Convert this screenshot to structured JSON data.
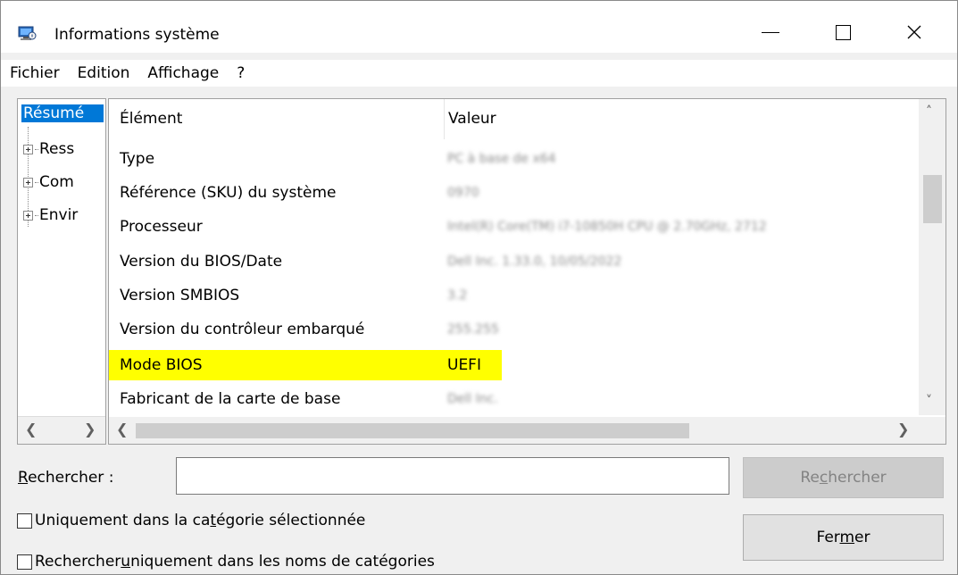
{
  "window": {
    "title": "Informations système",
    "icon": "system-info-icon"
  },
  "menu": [
    "Fichier",
    "Edition",
    "Affichage",
    "?"
  ],
  "tree": {
    "root": "Résumé",
    "items": [
      "Ress",
      "Com",
      "Envir"
    ]
  },
  "list": {
    "headers": {
      "element": "Élément",
      "value": "Valeur"
    },
    "rows": [
      {
        "name": "Type",
        "value": "PC à base de x64"
      },
      {
        "name": "Référence (SKU) du système",
        "value": "0970"
      },
      {
        "name": "Processeur",
        "value": "Intel(R) Core(TM) i7-10850H CPU @ 2.70GHz, 2712"
      },
      {
        "name": "Version du BIOS/Date",
        "value": "Dell Inc. 1.33.0, 10/05/2022"
      },
      {
        "name": "Version SMBIOS",
        "value": "3.2"
      },
      {
        "name": "Version du contrôleur embarqué",
        "value": "255.255"
      },
      {
        "name": "Mode BIOS",
        "value": "UEFI",
        "highlight": true
      },
      {
        "name": "Fabricant de la carte de base",
        "value": "Dell Inc."
      }
    ]
  },
  "search": {
    "label_pre": "",
    "label_u": "R",
    "label_post": "echercher :",
    "value": "",
    "button_pre": "Re",
    "button_u": "c",
    "button_post": "hercher"
  },
  "options": {
    "opt1_pre": "Uniquement dans la ca",
    "opt1_u": "t",
    "opt1_post": "égorie sélectionnée",
    "opt2_pre": "Rechercher ",
    "opt2_u": "u",
    "opt2_post": "niquement dans les noms de catégories"
  },
  "close_button": {
    "pre": "Fer",
    "u": "m",
    "post": "er"
  },
  "colors": {
    "selection": "#0078d7",
    "highlight": "#ffff00"
  }
}
